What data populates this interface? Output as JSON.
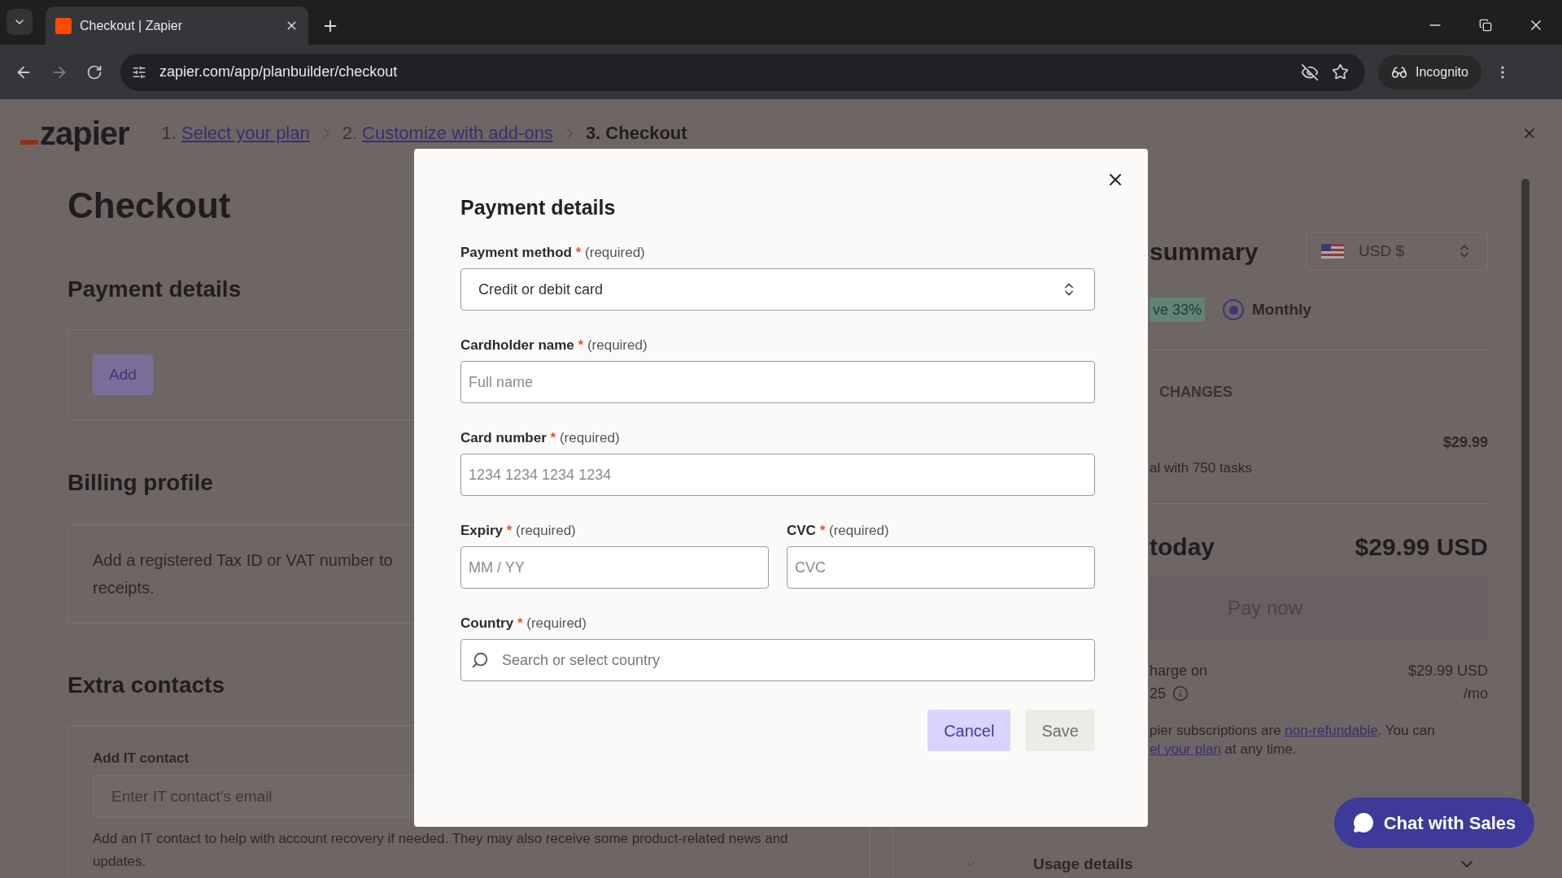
{
  "browser": {
    "tab_title": "Checkout | Zapier",
    "url": "zapier.com/app/planbuilder/checkout",
    "profile": "Incognito"
  },
  "header": {
    "logo": "zapier",
    "steps": [
      {
        "number": "1.",
        "label": "Select your plan",
        "kind": "link"
      },
      {
        "number": "2.",
        "label": "Customize with add-ons",
        "kind": "link"
      },
      {
        "number": "3.",
        "label": "Checkout",
        "kind": "current"
      }
    ]
  },
  "page": {
    "title": "Checkout",
    "payment": {
      "heading": "Payment details",
      "button": "Add"
    },
    "billing": {
      "heading": "Billing profile",
      "text": "Add a registered Tax ID or VAT number to receipts."
    },
    "contacts": {
      "heading": "Extra contacts",
      "field_label": "Add IT contact",
      "placeholder": "Enter IT contact's email",
      "help": "Add an IT contact to help with account recovery if needed. They may also receive some product-related news and updates."
    }
  },
  "summary": {
    "title": "summary",
    "currency": "USD $",
    "badge": "ve 33%",
    "billing_option": {
      "label": "Monthly",
      "selected": true
    },
    "section_label": "CHANGES",
    "line_price": "$29.99",
    "line_desc": "al with 750 tasks",
    "total_label": "today",
    "total": "$29.99 USD",
    "pay_button": {
      "label": "Pay now",
      "disabled": true
    },
    "next_charge": [
      "harge on",
      "25"
    ],
    "next_amount": "$29.99 USD",
    "next_period": "/mo",
    "notice": [
      [
        {
          "text": "pier subscriptions are ",
          "link": false
        },
        {
          "text": "non-refundable",
          "link": true
        },
        {
          "text": ". You can",
          "link": false
        }
      ],
      [
        {
          "text": "el your plan",
          "link": true
        },
        {
          "text": " at any time.",
          "link": false
        }
      ]
    ],
    "usage": "Usage details"
  },
  "chat_button": "Chat with Sales",
  "modal": {
    "title": "Payment details",
    "rows": [
      [
        {
          "label": "Payment method",
          "mark": "*",
          "note": "(required)",
          "kind": "select",
          "value": "Credit or debit card"
        }
      ],
      [
        {
          "label": "Cardholder name",
          "mark": "*",
          "note": "(required)",
          "kind": "text",
          "placeholder": "Full name"
        }
      ],
      [
        {
          "label": "Card number",
          "mark": "*",
          "note": "(required)",
          "kind": "text",
          "placeholder": "1234 1234 1234 1234"
        }
      ],
      [
        {
          "label": "Expiry",
          "mark": "*",
          "note": "(required)",
          "kind": "text",
          "placeholder": "MM / YY"
        },
        {
          "label": "CVC",
          "mark": "*",
          "note": "(required)",
          "kind": "text",
          "placeholder": "CVC"
        }
      ],
      [
        {
          "label": "Country",
          "mark": "*",
          "note": "(required)",
          "kind": "search",
          "placeholder": "Search or select country"
        }
      ]
    ],
    "buttons": [
      {
        "label": "Cancel",
        "kind": "secondary",
        "disabled": false
      },
      {
        "label": "Save",
        "kind": "primary",
        "disabled": true
      }
    ]
  }
}
